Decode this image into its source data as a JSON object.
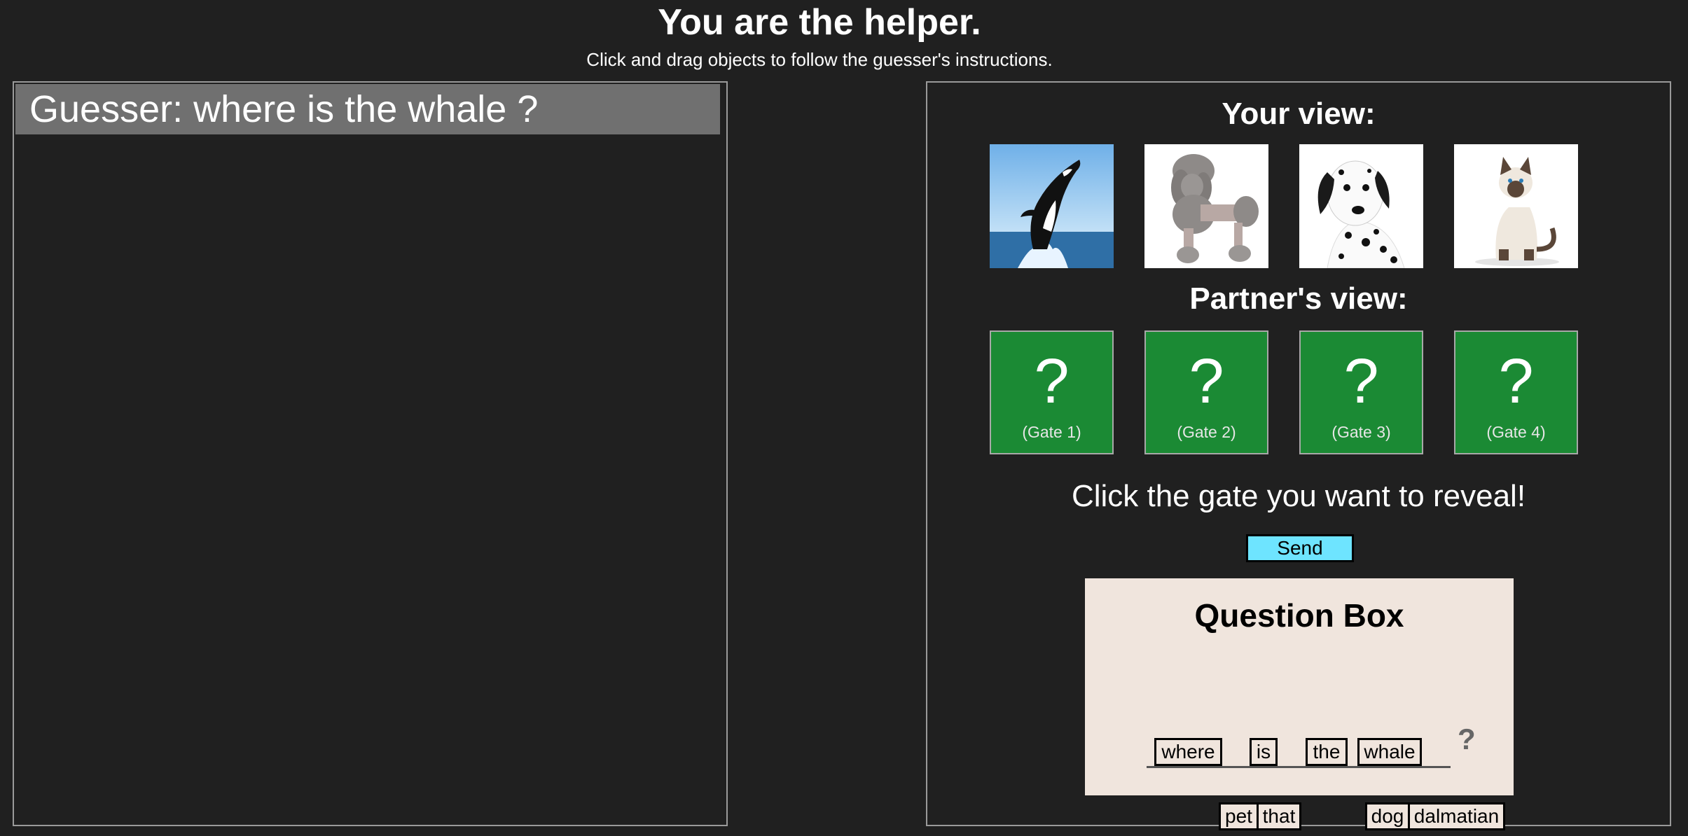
{
  "header": {
    "title": "You are the helper.",
    "subtitle": "Click and drag objects to follow the guesser's instructions."
  },
  "chat": {
    "messages": [
      "Guesser: where is the whale ?"
    ]
  },
  "game": {
    "your_view_label": "Your view:",
    "partners_view_label": "Partner's view:",
    "your_view_images": [
      "orca-whale-photo",
      "grey-poodle-photo",
      "dalmatian-photo",
      "siamese-cat-photo"
    ],
    "gates": [
      {
        "symbol": "?",
        "label": "(Gate 1)"
      },
      {
        "symbol": "?",
        "label": "(Gate 2)"
      },
      {
        "symbol": "?",
        "label": "(Gate 3)"
      },
      {
        "symbol": "?",
        "label": "(Gate 4)"
      }
    ],
    "gate_color": "#1b8a34",
    "instruction": "Click the gate you want to reveal!",
    "send_label": "Send",
    "send_color": "#6ee4ff"
  },
  "question_box": {
    "title": "Question Box",
    "sentence_words": [
      "where",
      "is",
      "the",
      "whale"
    ],
    "question_mark": "?",
    "bank_words": [
      "pet",
      "that",
      "dog",
      "dalmatian"
    ]
  }
}
